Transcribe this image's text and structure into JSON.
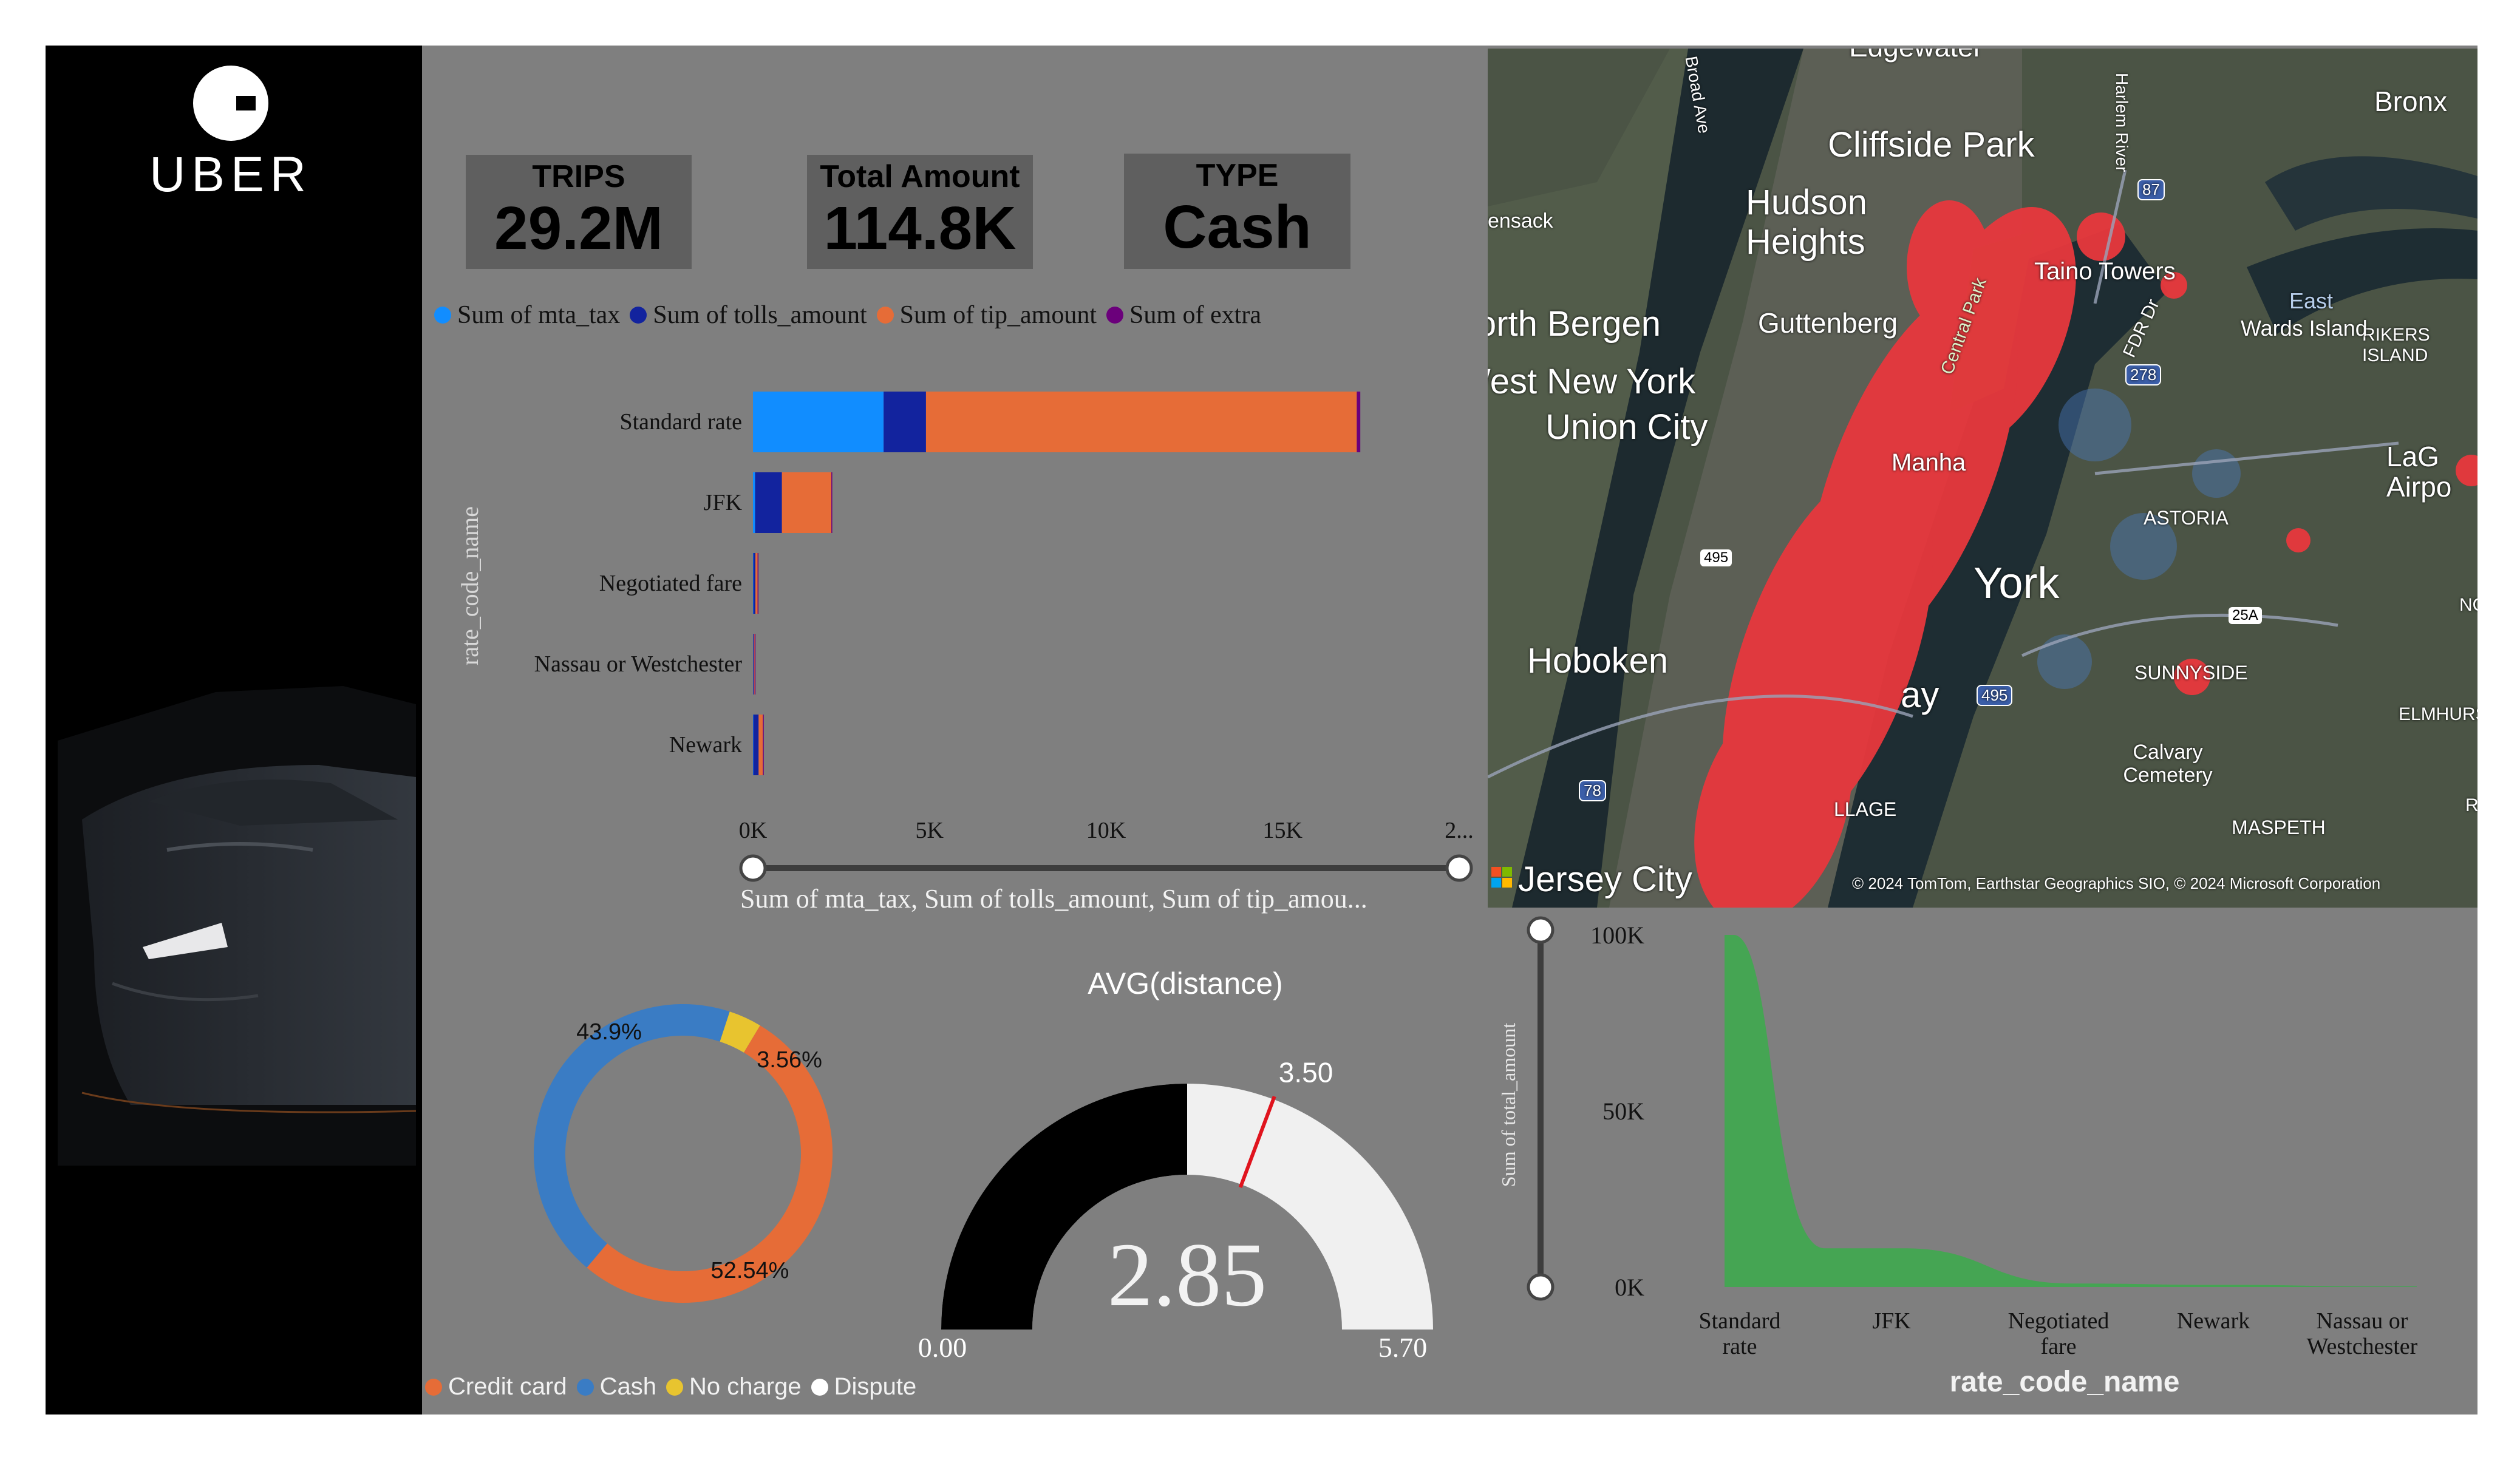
{
  "brand": {
    "logo_text": "UBER"
  },
  "kpis": [
    {
      "label": "TRIPS",
      "value": "29.2M"
    },
    {
      "label": "Total Amount",
      "value": "114.8K"
    },
    {
      "label": "TYPE",
      "value": "Cash"
    }
  ],
  "bar_legend": [
    {
      "label": "Sum of mta_tax",
      "color": "#118dff"
    },
    {
      "label": "Sum of tolls_amount",
      "color": "#12239e"
    },
    {
      "label": "Sum of tip_amount",
      "color": "#e66c37"
    },
    {
      "label": "Sum of extra",
      "color": "#6b007b"
    }
  ],
  "bar_axis": {
    "y_title": "rate_code_name",
    "x_title": "Sum of mta_tax, Sum of tolls_amount, Sum of tip_amou...",
    "ticks": [
      "0K",
      "5K",
      "10K",
      "15K",
      "2..."
    ]
  },
  "donut_legend": [
    {
      "label": "Credit card",
      "color": "#e66c37"
    },
    {
      "label": "Cash",
      "color": "#3a7cc4"
    },
    {
      "label": "No charge",
      "color": "#e8c42f"
    },
    {
      "label": "Dispute",
      "color": "#ffffff"
    }
  ],
  "gauge": {
    "title": "AVG(distance)",
    "value_label": "2.85",
    "min_label": "0.00",
    "max_label": "5.70",
    "target_label": "3.50"
  },
  "map": {
    "labels": [
      "Edgewater",
      "Bronx",
      "Cliffside Park",
      "Hudson",
      "Heights",
      "Guttenberg",
      "North Bergen",
      "West New York",
      "Union City",
      "Manha",
      "York",
      "Hoboken",
      "Jersey City",
      "ASTORIA",
      "RIKERS ISLAND",
      "Wards Island",
      "East",
      "Taino Towers",
      "LaG",
      "Airpo",
      "Calvary Cemetery",
      "MASPETH",
      "ELMHURS",
      "SUNNYSIDE",
      "LLAGE",
      "ensack",
      "Central Park",
      "FDR Dr",
      "Broad Ave",
      "Harlem River",
      "NO",
      "R",
      "ay"
    ],
    "shields": [
      "87",
      "278",
      "495",
      "495",
      "25A",
      "78"
    ],
    "copyright": "© 2024 TomTom, Earthstar Geographics SIO, © 2024 Microsoft Corporation"
  },
  "area_axis": {
    "y_title": "Sum of total_amount",
    "x_title": "rate_code_name",
    "y_ticks": [
      "100K",
      "50K",
      "0K"
    ],
    "x_ticks": [
      [
        "Standard",
        "rate"
      ],
      [
        "JFK",
        ""
      ],
      [
        "Negotiated",
        "fare"
      ],
      [
        "Newark",
        ""
      ],
      [
        "Nassau or",
        "Westchester"
      ]
    ]
  },
  "chart_data": [
    {
      "type": "bar",
      "orientation": "horizontal",
      "stacked": true,
      "categories": [
        "Standard rate",
        "JFK",
        "Negotiated fare",
        "Nassau or Westchester",
        "Newark"
      ],
      "series": [
        {
          "name": "Sum of mta_tax",
          "values": [
            3700,
            60,
            10,
            5,
            10
          ]
        },
        {
          "name": "Sum of tolls_amount",
          "values": [
            1200,
            760,
            60,
            20,
            150
          ]
        },
        {
          "name": "Sum of tip_amount",
          "values": [
            12200,
            1400,
            60,
            20,
            120
          ]
        },
        {
          "name": "Sum of extra",
          "values": [
            100,
            10,
            5,
            2,
            5
          ]
        }
      ],
      "xlabel": "Sum of mta_tax, Sum of tolls_amount, Sum of tip_amou...",
      "ylabel": "rate_code_name",
      "xlim": [
        0,
        20000
      ],
      "colors": [
        "#118dff",
        "#12239e",
        "#e66c37",
        "#6b007b"
      ]
    },
    {
      "type": "pie",
      "style": "donut",
      "categories": [
        "Credit card",
        "Cash",
        "No charge",
        "Dispute"
      ],
      "values": [
        52.54,
        43.9,
        3.56,
        0.0
      ],
      "data_labels": [
        "52.54%",
        "43.9%",
        "3.56%",
        ""
      ],
      "colors": [
        "#e66c37",
        "#3a7cc4",
        "#e8c42f",
        "#ffffff"
      ]
    },
    {
      "type": "gauge",
      "title": "AVG(distance)",
      "value": 2.85,
      "min": 0.0,
      "max": 5.7,
      "target": 3.5
    },
    {
      "type": "area",
      "categories": [
        "Standard rate",
        "JFK",
        "Negotiated fare",
        "Newark",
        "Nassau or Westchester"
      ],
      "values": [
        100000,
        11000,
        1000,
        600,
        200
      ],
      "xlabel": "rate_code_name",
      "ylabel": "Sum of total_amount",
      "ylim": [
        0,
        100000
      ],
      "color": "#4caf50"
    }
  ]
}
